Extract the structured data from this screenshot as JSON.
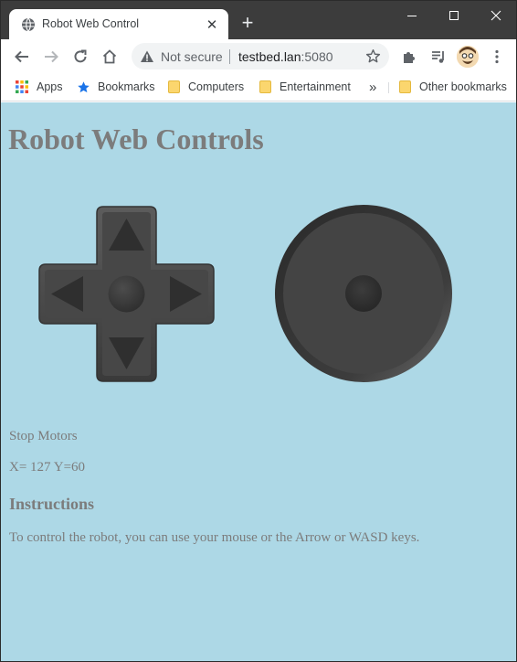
{
  "browser": {
    "tab": {
      "title": "Robot Web Control",
      "close_glyph": "✕",
      "favicon": "globe-icon"
    },
    "new_tab_glyph": "+",
    "omnibox": {
      "security_text": "Not secure",
      "host": "testbed.lan",
      "port": ":5080",
      "warning_icon": "warning-triangle-icon",
      "star_icon": "star-outline-icon"
    },
    "bookmarks": [
      {
        "label": "Apps",
        "icon": "apps-grid-icon"
      },
      {
        "label": "Bookmarks",
        "icon": "star-icon"
      },
      {
        "label": "Computers",
        "icon": "folder-icon"
      },
      {
        "label": "Entertainment",
        "icon": "folder-icon"
      },
      {
        "label": "Other bookmarks",
        "icon": "folder-icon"
      }
    ],
    "overflow_glyph": "»",
    "colors": {
      "frame": "#3c3c3c",
      "accent_blue": "#1a73e8"
    }
  },
  "page": {
    "title": "Robot Web Controls",
    "stop_label": "Stop Motors",
    "coords_text": "X= 127 Y=60",
    "instructions_heading": "Instructions",
    "instructions_text": "To control the robot, you can use your mouse or the Arrow or WASD keys.",
    "colors": {
      "background": "#add8e6",
      "text": "#7c7c7c",
      "control": "#4a4a4a"
    }
  }
}
